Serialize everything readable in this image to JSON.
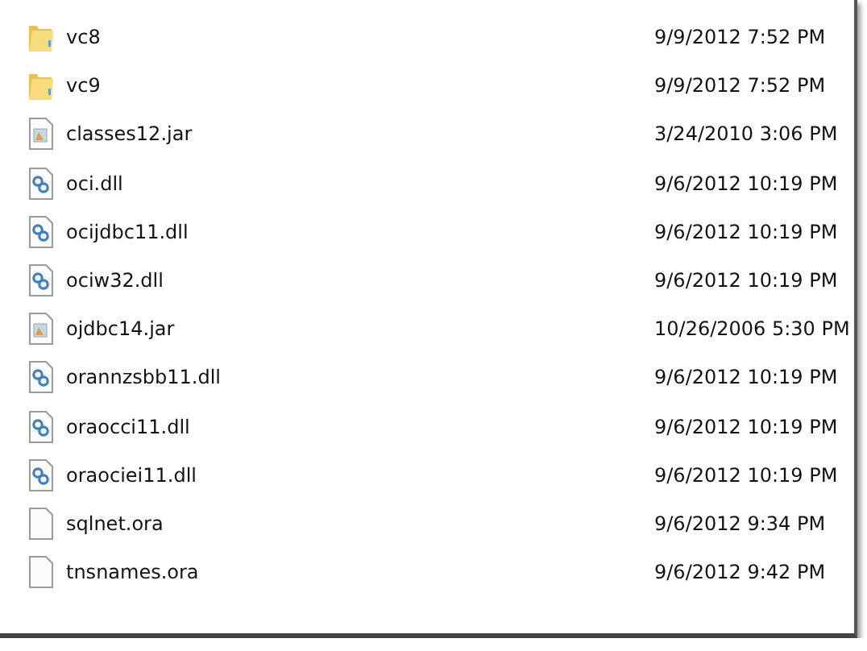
{
  "files": [
    {
      "kind": "folder",
      "name": "vc8",
      "modified": "9/9/2012 7:52 PM"
    },
    {
      "kind": "folder",
      "name": "vc9",
      "modified": "9/9/2012 7:52 PM"
    },
    {
      "kind": "jar",
      "name": "classes12.jar",
      "modified": "3/24/2010 3:06 PM"
    },
    {
      "kind": "dll",
      "name": "oci.dll",
      "modified": "9/6/2012 10:19 PM"
    },
    {
      "kind": "dll",
      "name": "ocijdbc11.dll",
      "modified": "9/6/2012 10:19 PM"
    },
    {
      "kind": "dll",
      "name": "ociw32.dll",
      "modified": "9/6/2012 10:19 PM"
    },
    {
      "kind": "jar",
      "name": "ojdbc14.jar",
      "modified": "10/26/2006 5:30 PM"
    },
    {
      "kind": "dll",
      "name": "orannzsbb11.dll",
      "modified": "9/6/2012 10:19 PM"
    },
    {
      "kind": "dll",
      "name": "oraocci11.dll",
      "modified": "9/6/2012 10:19 PM"
    },
    {
      "kind": "dll",
      "name": "oraociei11.dll",
      "modified": "9/6/2012 10:19 PM"
    },
    {
      "kind": "file",
      "name": "sqlnet.ora",
      "modified": "9/6/2012 9:34 PM"
    },
    {
      "kind": "file",
      "name": "tnsnames.ora",
      "modified": "9/6/2012 9:42 PM"
    }
  ]
}
